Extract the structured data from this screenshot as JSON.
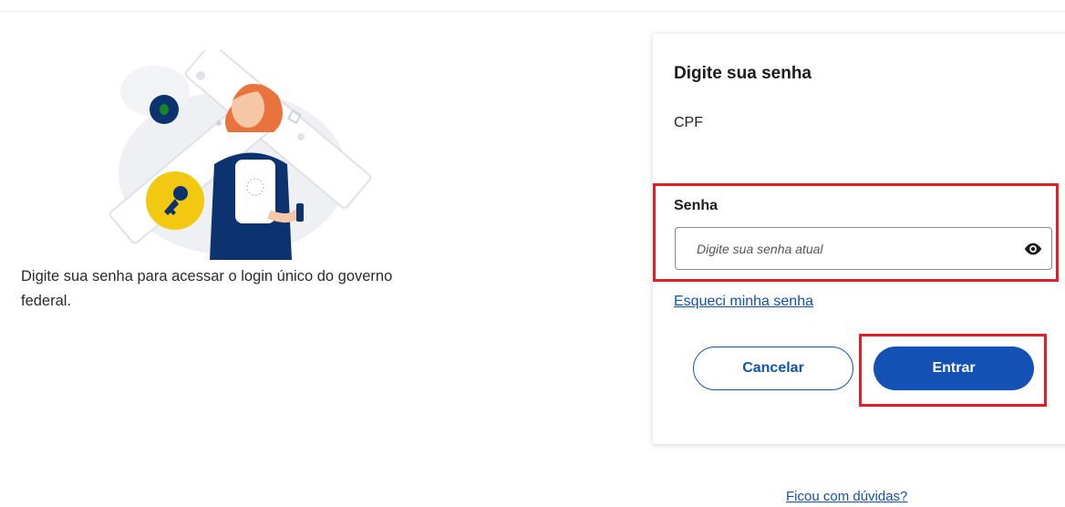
{
  "intro": {
    "text": "Digite sua senha para acessar o login único do governo federal."
  },
  "card": {
    "title": "Digite sua senha",
    "cpf_label": "CPF",
    "password": {
      "label": "Senha",
      "placeholder": "Digite sua senha atual",
      "value": "",
      "toggle_icon": "eye-icon"
    },
    "forgot_link": "Esqueci minha senha",
    "cancel_label": "Cancelar",
    "enter_label": "Entrar"
  },
  "help_link": "Ficou com dúvidas?",
  "colors": {
    "primary": "#1351b4",
    "highlight": "#e41e26",
    "key_badge": "#f2c811"
  }
}
